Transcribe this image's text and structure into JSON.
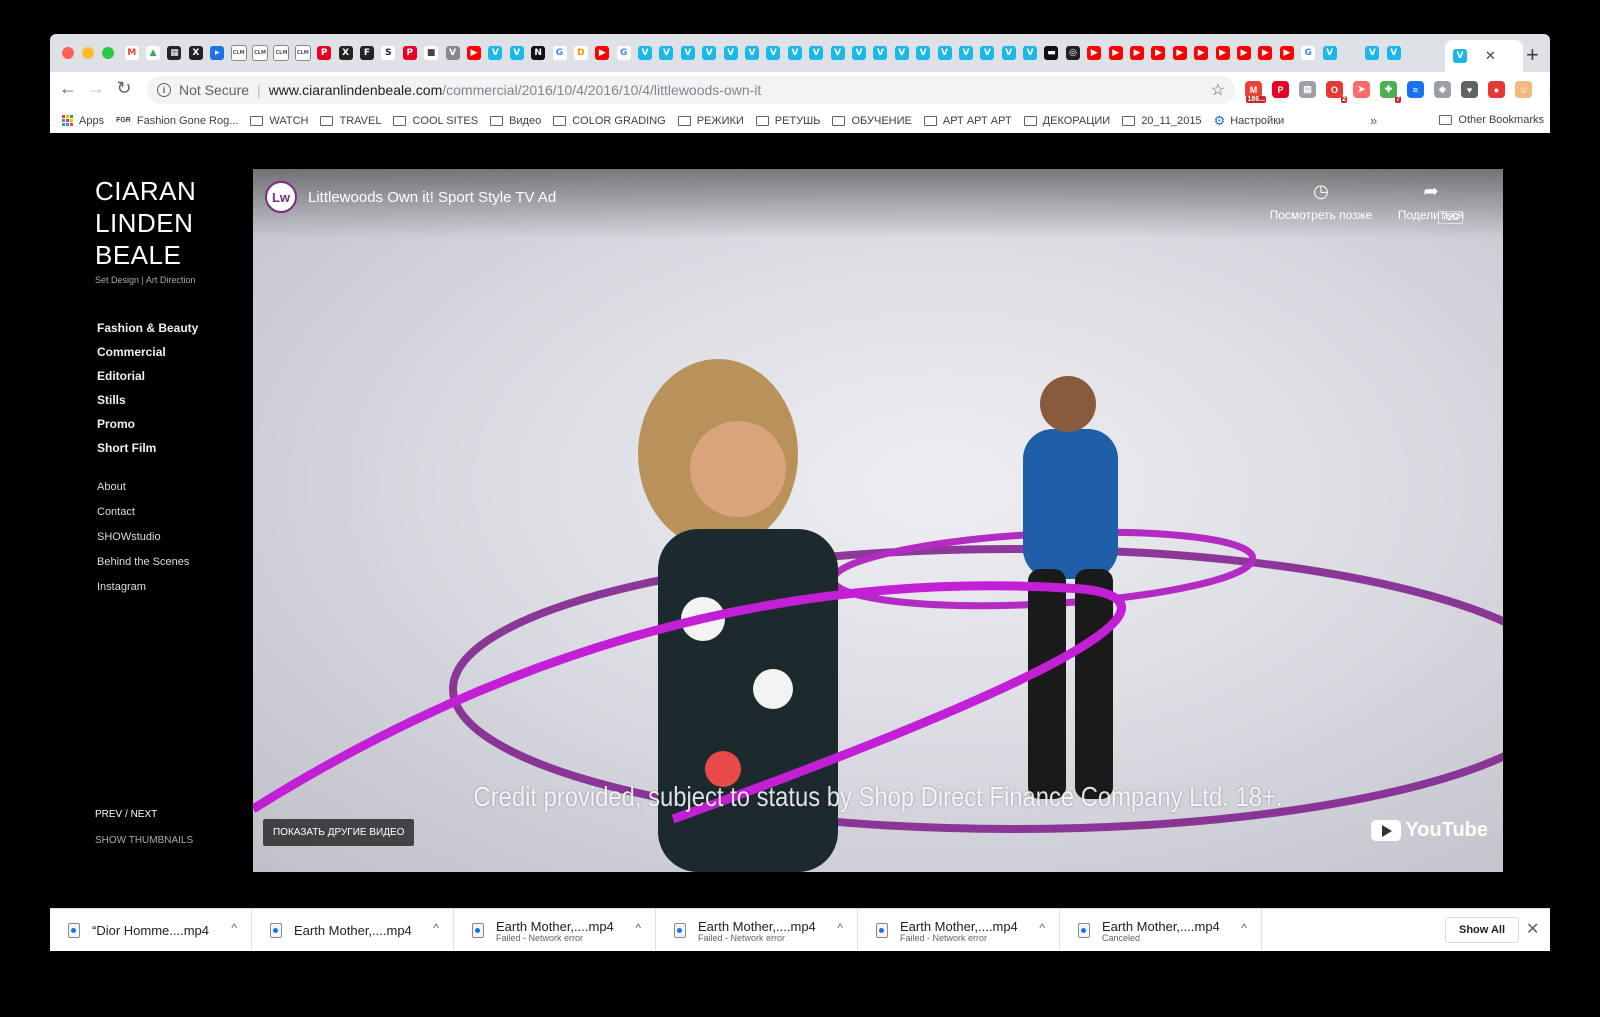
{
  "browser": {
    "tabs": [
      {
        "icon": "gmail-icon",
        "glyph": "M",
        "color": "#ea4335",
        "bg": "#ffffff"
      },
      {
        "icon": "drive-icon",
        "glyph": "▲",
        "color": "#34a853",
        "bg": "#ffffff"
      },
      {
        "icon": "app-icon",
        "glyph": "▦",
        "color": "#ffffff",
        "bg": "#222222"
      },
      {
        "icon": "x-icon",
        "glyph": "X",
        "color": "#ffffff",
        "bg": "#222222"
      },
      {
        "icon": "blue-box-icon",
        "glyph": "▸",
        "color": "#ffffff",
        "bg": "#1a73e8"
      },
      {
        "icon": "clm-icon",
        "glyph": "CLM",
        "color": "#555555",
        "bg": "#ffffff"
      },
      {
        "icon": "clm-icon",
        "glyph": "CLM",
        "color": "#555555",
        "bg": "#ffffff"
      },
      {
        "icon": "clm-icon",
        "glyph": "CLM",
        "color": "#555555",
        "bg": "#ffffff"
      },
      {
        "icon": "clm-icon",
        "glyph": "CLM",
        "color": "#555555",
        "bg": "#ffffff"
      },
      {
        "icon": "pinterest-icon",
        "glyph": "P",
        "color": "#ffffff",
        "bg": "#e60023"
      },
      {
        "icon": "x-icon",
        "glyph": "X",
        "color": "#ffffff",
        "bg": "#222222"
      },
      {
        "icon": "f-icon",
        "glyph": "F",
        "color": "#ffffff",
        "bg": "#222222"
      },
      {
        "icon": "s-icon",
        "glyph": "S",
        "color": "#222222",
        "bg": "#ffffff"
      },
      {
        "icon": "pinterest-icon",
        "glyph": "P",
        "color": "#ffffff",
        "bg": "#e60023"
      },
      {
        "icon": "cube-icon",
        "glyph": "■",
        "color": "#444444",
        "bg": "#ffffff"
      },
      {
        "icon": "v-icon",
        "glyph": "V",
        "color": "#ffffff",
        "bg": "#888888"
      },
      {
        "icon": "youtube-icon",
        "glyph": "▶",
        "color": "#ffffff",
        "bg": "#ff0000"
      },
      {
        "icon": "vimeo-icon",
        "glyph": "V",
        "color": "#ffffff",
        "bg": "#1ab7ea"
      },
      {
        "icon": "vimeo-icon",
        "glyph": "V",
        "color": "#ffffff",
        "bg": "#1ab7ea"
      },
      {
        "icon": "n-icon",
        "glyph": "N",
        "color": "#ffffff",
        "bg": "#111111"
      },
      {
        "icon": "google-icon",
        "glyph": "G",
        "color": "#4285f4",
        "bg": "#ffffff"
      },
      {
        "icon": "d-icon",
        "glyph": "D",
        "color": "#ff8c00",
        "bg": "#ffffff"
      },
      {
        "icon": "youtube-icon",
        "glyph": "▶",
        "color": "#ffffff",
        "bg": "#ff0000"
      },
      {
        "icon": "google-icon",
        "glyph": "G",
        "color": "#4285f4",
        "bg": "#ffffff"
      },
      {
        "icon": "vimeo-icon",
        "glyph": "V",
        "color": "#ffffff",
        "bg": "#1ab7ea"
      },
      {
        "icon": "vimeo-icon",
        "glyph": "V",
        "color": "#ffffff",
        "bg": "#1ab7ea"
      },
      {
        "icon": "vimeo-icon",
        "glyph": "V",
        "color": "#ffffff",
        "bg": "#1ab7ea"
      },
      {
        "icon": "vimeo-icon",
        "glyph": "V",
        "color": "#ffffff",
        "bg": "#1ab7ea"
      },
      {
        "icon": "vimeo-icon",
        "glyph": "V",
        "color": "#ffffff",
        "bg": "#1ab7ea"
      },
      {
        "icon": "vimeo-icon",
        "glyph": "V",
        "color": "#ffffff",
        "bg": "#1ab7ea"
      },
      {
        "icon": "vimeo-icon",
        "glyph": "V",
        "color": "#ffffff",
        "bg": "#1ab7ea"
      },
      {
        "icon": "vimeo-icon",
        "glyph": "V",
        "color": "#ffffff",
        "bg": "#1ab7ea"
      },
      {
        "icon": "vimeo-icon",
        "glyph": "V",
        "color": "#ffffff",
        "bg": "#1ab7ea"
      },
      {
        "icon": "vimeo-icon",
        "glyph": "V",
        "color": "#ffffff",
        "bg": "#1ab7ea"
      },
      {
        "icon": "vimeo-icon",
        "glyph": "V",
        "color": "#ffffff",
        "bg": "#1ab7ea"
      },
      {
        "icon": "vimeo-icon",
        "glyph": "V",
        "color": "#ffffff",
        "bg": "#1ab7ea"
      },
      {
        "icon": "vimeo-icon",
        "glyph": "V",
        "color": "#ffffff",
        "bg": "#1ab7ea"
      },
      {
        "icon": "vimeo-icon",
        "glyph": "V",
        "color": "#ffffff",
        "bg": "#1ab7ea"
      },
      {
        "icon": "vimeo-icon",
        "glyph": "V",
        "color": "#ffffff",
        "bg": "#1ab7ea"
      },
      {
        "icon": "vimeo-icon",
        "glyph": "V",
        "color": "#ffffff",
        "bg": "#1ab7ea"
      },
      {
        "icon": "vimeo-icon",
        "glyph": "V",
        "color": "#ffffff",
        "bg": "#1ab7ea"
      },
      {
        "icon": "vimeo-icon",
        "glyph": "V",
        "color": "#ffffff",
        "bg": "#1ab7ea"
      },
      {
        "icon": "vimeo-icon",
        "glyph": "V",
        "color": "#ffffff",
        "bg": "#1ab7ea"
      },
      {
        "icon": "dark-box-icon",
        "glyph": "▬",
        "color": "#ffffff",
        "bg": "#111111"
      },
      {
        "icon": "circle-logo-icon",
        "glyph": "◎",
        "color": "#ffffff",
        "bg": "#222222"
      },
      {
        "icon": "youtube-icon",
        "glyph": "▶",
        "color": "#ffffff",
        "bg": "#ff0000"
      },
      {
        "icon": "youtube-icon",
        "glyph": "▶",
        "color": "#ffffff",
        "bg": "#ff0000"
      },
      {
        "icon": "youtube-icon",
        "glyph": "▶",
        "color": "#ffffff",
        "bg": "#ff0000"
      },
      {
        "icon": "youtube-icon",
        "glyph": "▶",
        "color": "#ffffff",
        "bg": "#ff0000"
      },
      {
        "icon": "youtube-icon",
        "glyph": "▶",
        "color": "#ffffff",
        "bg": "#ff0000"
      },
      {
        "icon": "youtube-icon",
        "glyph": "▶",
        "color": "#ffffff",
        "bg": "#ff0000"
      },
      {
        "icon": "youtube-icon",
        "glyph": "▶",
        "color": "#ffffff",
        "bg": "#ff0000"
      },
      {
        "icon": "youtube-icon",
        "glyph": "▶",
        "color": "#ffffff",
        "bg": "#ff0000"
      },
      {
        "icon": "youtube-icon",
        "glyph": "▶",
        "color": "#ffffff",
        "bg": "#ff0000"
      },
      {
        "icon": "youtube-icon",
        "glyph": "▶",
        "color": "#ffffff",
        "bg": "#ff0000"
      },
      {
        "icon": "google-icon",
        "glyph": "G",
        "color": "#4285f4",
        "bg": "#ffffff"
      },
      {
        "icon": "vimeo-icon",
        "glyph": "V",
        "color": "#ffffff",
        "bg": "#1ab7ea"
      },
      {
        "icon": "blank-icon",
        "glyph": "",
        "color": "#ffffff",
        "bg": "#dee1e6"
      },
      {
        "icon": "vimeo-icon",
        "glyph": "V",
        "color": "#ffffff",
        "bg": "#1ab7ea"
      },
      {
        "icon": "vimeo-icon",
        "glyph": "V",
        "color": "#ffffff",
        "bg": "#1ab7ea"
      }
    ],
    "active_tab": {
      "icon": "vimeo-icon",
      "glyph": "V",
      "close": "✕"
    },
    "new_tab": "+",
    "nav": {
      "back": "←",
      "forward": "→",
      "reload": "↻"
    },
    "omnibox": {
      "info": "i",
      "security": "Not Secure",
      "separator": "|",
      "host": "www.ciaranlindenbeale.com",
      "path": "/commercial/2016/10/4/2016/10/4/littlewoods-own-it",
      "star": "☆"
    },
    "extensions": [
      {
        "icon": "gmail-icon",
        "glyph": "M",
        "bg": "#ea4335",
        "badge": "186..."
      },
      {
        "icon": "pinterest-icon",
        "glyph": "P",
        "bg": "#e60023"
      },
      {
        "icon": "store-icon",
        "glyph": "▤",
        "bg": "#9aa0a6"
      },
      {
        "icon": "opera-icon",
        "glyph": "O",
        "bg": "#e53935",
        "badge": "2"
      },
      {
        "icon": "arrow-icon",
        "glyph": "➤",
        "bg": "#ff6b6b"
      },
      {
        "icon": "puzzle-icon",
        "glyph": "✚",
        "bg": "#4caf50",
        "badge": "7"
      },
      {
        "icon": "wave-icon",
        "glyph": "≈",
        "bg": "#1a73e8"
      },
      {
        "icon": "shield-icon",
        "glyph": "◈",
        "bg": "#9aa0a6"
      },
      {
        "icon": "pocket-icon",
        "glyph": "♥",
        "bg": "#5f6368"
      },
      {
        "icon": "pin-icon",
        "glyph": "●",
        "bg": "#e53935"
      },
      {
        "icon": "avatar-icon",
        "glyph": "☺",
        "bg": "#f2b880"
      },
      {
        "icon": "menu-icon",
        "glyph": "⋮",
        "bg": "#ffffff"
      }
    ],
    "bookmarks": {
      "apps": "Apps",
      "items": [
        {
          "label": "Fashion Gone Rog...",
          "icon": "fgr-icon"
        },
        {
          "label": "WATCH",
          "icon": "folder-icon"
        },
        {
          "label": "TRAVEL",
          "icon": "folder-icon"
        },
        {
          "label": "COOL SITES",
          "icon": "folder-icon"
        },
        {
          "label": "Видео",
          "icon": "folder-icon"
        },
        {
          "label": "COLOR GRADING",
          "icon": "folder-icon"
        },
        {
          "label": "РЕЖИКИ",
          "icon": "folder-icon"
        },
        {
          "label": "РЕТУШЬ",
          "icon": "folder-icon"
        },
        {
          "label": "ОБУЧЕНИЕ",
          "icon": "folder-icon"
        },
        {
          "label": "АРТ АРТ АРТ",
          "icon": "folder-icon"
        },
        {
          "label": "ДЕКОРАЦИИ",
          "icon": "folder-icon"
        },
        {
          "label": "20_11_2015",
          "icon": "folder-icon"
        },
        {
          "label": "Настройки",
          "icon": "gear-icon"
        }
      ],
      "more": "»",
      "other": "Other Bookmarks"
    }
  },
  "site": {
    "title_lines": [
      "CIARAN",
      "LINDEN",
      "BEALE"
    ],
    "subtitle": "Set Design | Art Direction",
    "nav_main": [
      "Fashion & Beauty",
      "Commercial",
      "Editorial",
      "Stills",
      "Promo",
      "Short Film"
    ],
    "nav_secondary": [
      "About",
      "Contact",
      "SHOWstudio",
      "Behind the Scenes",
      "Instagram"
    ],
    "prev_next": "PREV / NEXT",
    "show_thumbnails": "SHOW THUMBNAILS"
  },
  "video": {
    "channel_logo": "Lw",
    "title": "Littlewoods Own it! Sport Style TV Ad",
    "watch_later": "Посмотреть позже",
    "share": "Поделиться",
    "quality": "720",
    "caption": "Credit provided, subject to status by Shop Direct Finance Company Ltd. 18+.",
    "more_videos": "ПОКАЗАТЬ ДРУГИЕ ВИДЕО",
    "youtube": "YouTube"
  },
  "downloads": {
    "items": [
      {
        "name": "“Dior Homme....mp4",
        "status": ""
      },
      {
        "name": "Earth Mother,....mp4",
        "status": ""
      },
      {
        "name": "Earth Mother,....mp4",
        "status": "Failed - Network error"
      },
      {
        "name": "Earth Mother,....mp4",
        "status": "Failed - Network error"
      },
      {
        "name": "Earth Mother,....mp4",
        "status": "Failed - Network error"
      },
      {
        "name": "Earth Mother,....mp4",
        "status": "Canceled"
      }
    ],
    "caret": "^",
    "show_all": "Show All",
    "close": "✕"
  }
}
